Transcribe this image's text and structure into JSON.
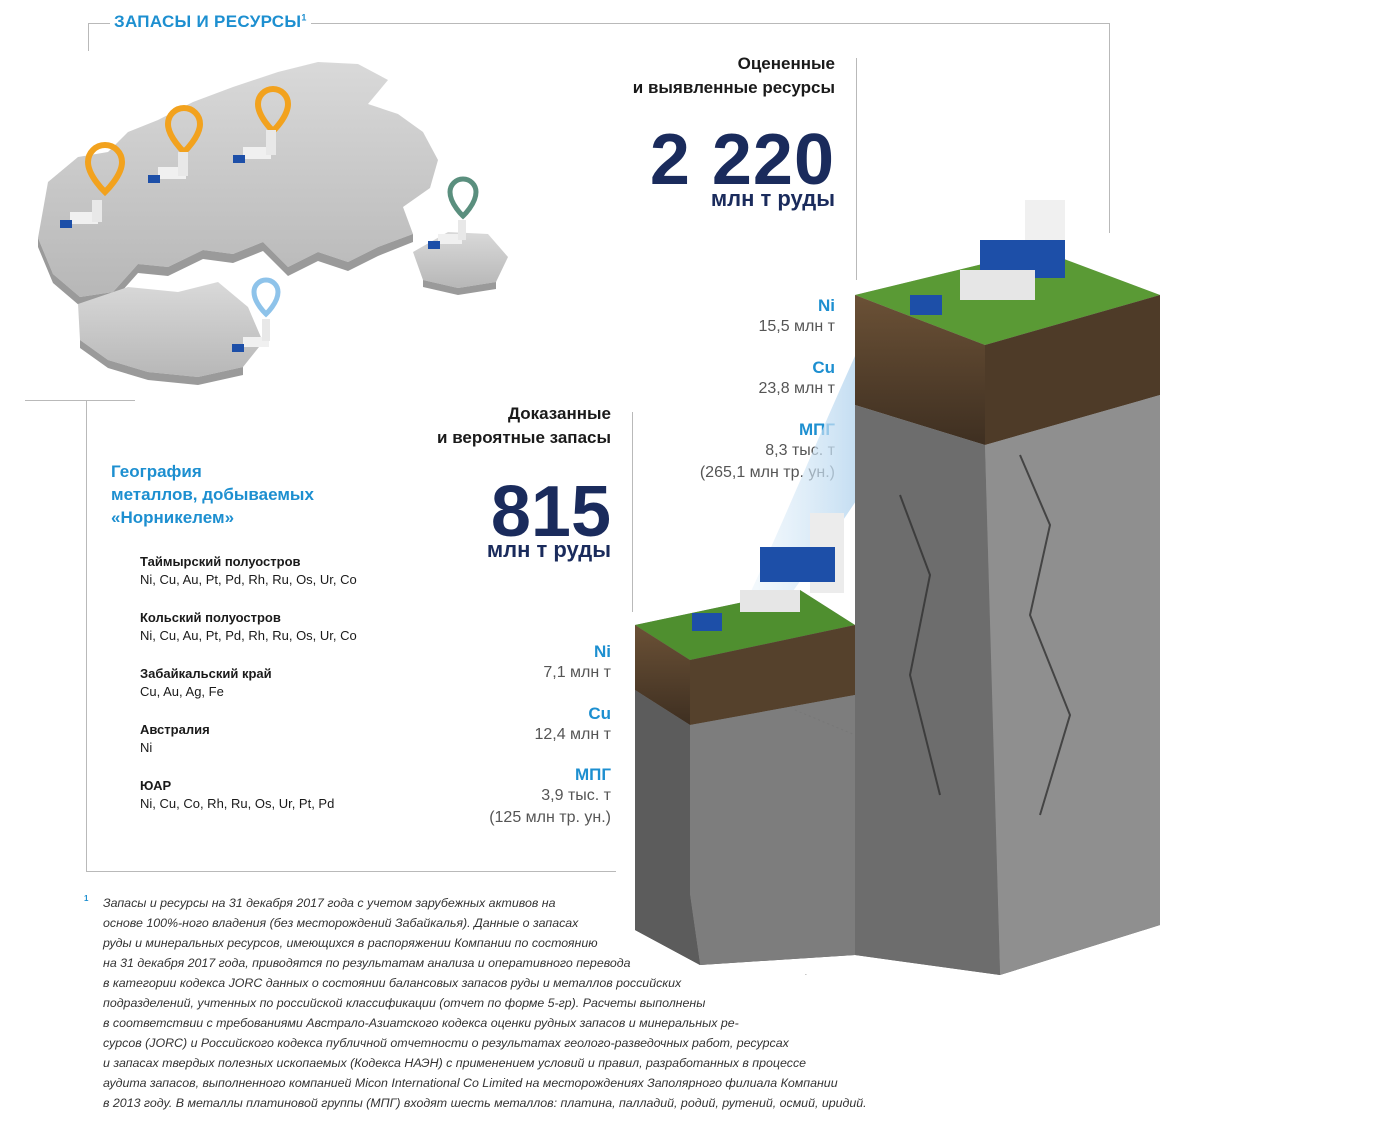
{
  "header": {
    "title": "ЗАПАСЫ И РЕСУРСЫ",
    "title_footnote": "1"
  },
  "resources": {
    "heading_line1": "Оцененные",
    "heading_line2": "и выявленные ресурсы",
    "value": "2 220",
    "unit": "млн т руды",
    "metals": [
      {
        "name": "Ni",
        "value": "15,5 млн т"
      },
      {
        "name": "Cu",
        "value": "23,8 млн т"
      },
      {
        "name": "МПГ",
        "value": "8,3 тыс. т",
        "extra": "(265,1 млн тр. ун.)"
      }
    ]
  },
  "reserves": {
    "heading_line1": "Доказанные",
    "heading_line2": "и вероятные запасы",
    "value": "815",
    "unit": "млн т руды",
    "metals": [
      {
        "name": "Ni",
        "value": "7,1 млн т"
      },
      {
        "name": "Cu",
        "value": "12,4 млн т"
      },
      {
        "name": "МПГ",
        "value": "3,9 тыс. т",
        "extra": "(125 млн тр. ун.)"
      }
    ]
  },
  "geography": {
    "heading_line1": "География",
    "heading_line2": "металлов, добываемых",
    "heading_line3": "«Норникелем»",
    "regions": [
      {
        "name": "Таймырский полуостров",
        "metals": "Ni, Cu, Au, Pt, Pd, Rh, Ru, Os, Ur, Co"
      },
      {
        "name": "Кольский полуостров",
        "metals": "Ni, Cu, Au, Pt, Pd, Rh, Ru, Os, Ur, Co"
      },
      {
        "name": "Забайкальский край",
        "metals": "Cu, Au, Ag, Fe"
      },
      {
        "name": "Австралия",
        "metals": "Ni"
      },
      {
        "name": "ЮАР",
        "metals": "Ni, Cu, Co, Rh, Ru, Os, Ur, Pt, Pd"
      }
    ]
  },
  "colors": {
    "accent_blue": "#1d8fd0",
    "dark_navy": "#1a2b5c",
    "pin_orange": "#f2a21e",
    "pin_green": "#5a8f7e",
    "pin_lightblue": "#8ec3ea",
    "grass": "#4f8f2f",
    "rock": "#8a8a8a"
  },
  "icons": [
    "map-pin-icon",
    "plant-icon",
    "soil-column-icon"
  ],
  "footnote": {
    "mark": "1",
    "lines": [
      "Запасы и ресурсы на 31 декабря 2017 года с учетом зарубежных активов на",
      "основе 100%-ного владения (без месторождений Забайкалья). Данные о запасах",
      "руды и минеральных ресурсов, имеющихся в распоряжении Компании по состоянию",
      "на 31 декабря 2017 года, приводятся по результатам анализа и оперативного перевода",
      "в категории кодекса JORC данных о состоянии балансовых запасов руды и металлов российских",
      "подразделений, учтенных по российской классификации (отчет по форме 5-гр). Расчеты выполнены",
      "в соответствии с требованиями Австрало-Азиатского кодекса оценки рудных запасов и минеральных ре-",
      "сурсов (JORC) и Российского кодекса публичной отчетности о результатах геолого-разведочных работ, ресурсах",
      "и запасах твердых полезных ископаемых (Кодекса НАЭН) с применением условий и правил, разработанных в процессе",
      "аудита запасов, выполненного компанией Micon International Co Limited на месторождениях Заполярного филиала Компании",
      "в 2013 году. В металлы платиновой группы (МПГ) входят шесть металлов: платина, палладий, родий, рутений, осмий, иридий."
    ]
  }
}
